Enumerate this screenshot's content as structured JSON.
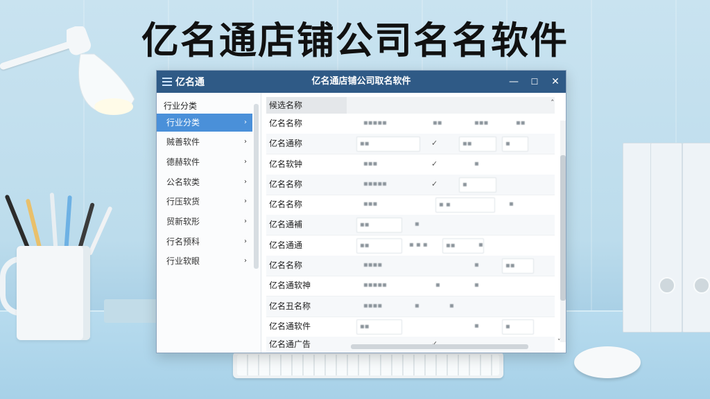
{
  "headline": "亿名通店铺公司名名软件",
  "window": {
    "brand": "亿名通",
    "title": "亿名通店铺公司取名软件",
    "minimize": "—",
    "maximize": "☐",
    "close": "✕"
  },
  "sidebar": {
    "header": "行业分类",
    "chevron": "›",
    "items": [
      {
        "label": "行业分类"
      },
      {
        "label": "贼善软件"
      },
      {
        "label": "德赫软件"
      },
      {
        "label": "公名软类"
      },
      {
        "label": "行压软货"
      },
      {
        "label": "贸新软形"
      },
      {
        "label": "行名预科"
      },
      {
        "label": "行业软眼"
      }
    ]
  },
  "main": {
    "column_header": "候选名称",
    "scroll_up": "˄",
    "scroll_down": "˅",
    "check_mark": "✓",
    "rows": [
      {
        "name": "亿名名称"
      },
      {
        "name": "亿名通称"
      },
      {
        "name": "亿名软钟"
      },
      {
        "name": "亿名名称"
      },
      {
        "name": "亿名名称"
      },
      {
        "name": "亿名通補"
      },
      {
        "name": "亿名通通"
      },
      {
        "name": "亿名名称"
      },
      {
        "name": "亿名通软神"
      },
      {
        "name": "亿名丑名称"
      },
      {
        "name": "亿名通软件"
      },
      {
        "name": "亿名通广告"
      }
    ]
  }
}
